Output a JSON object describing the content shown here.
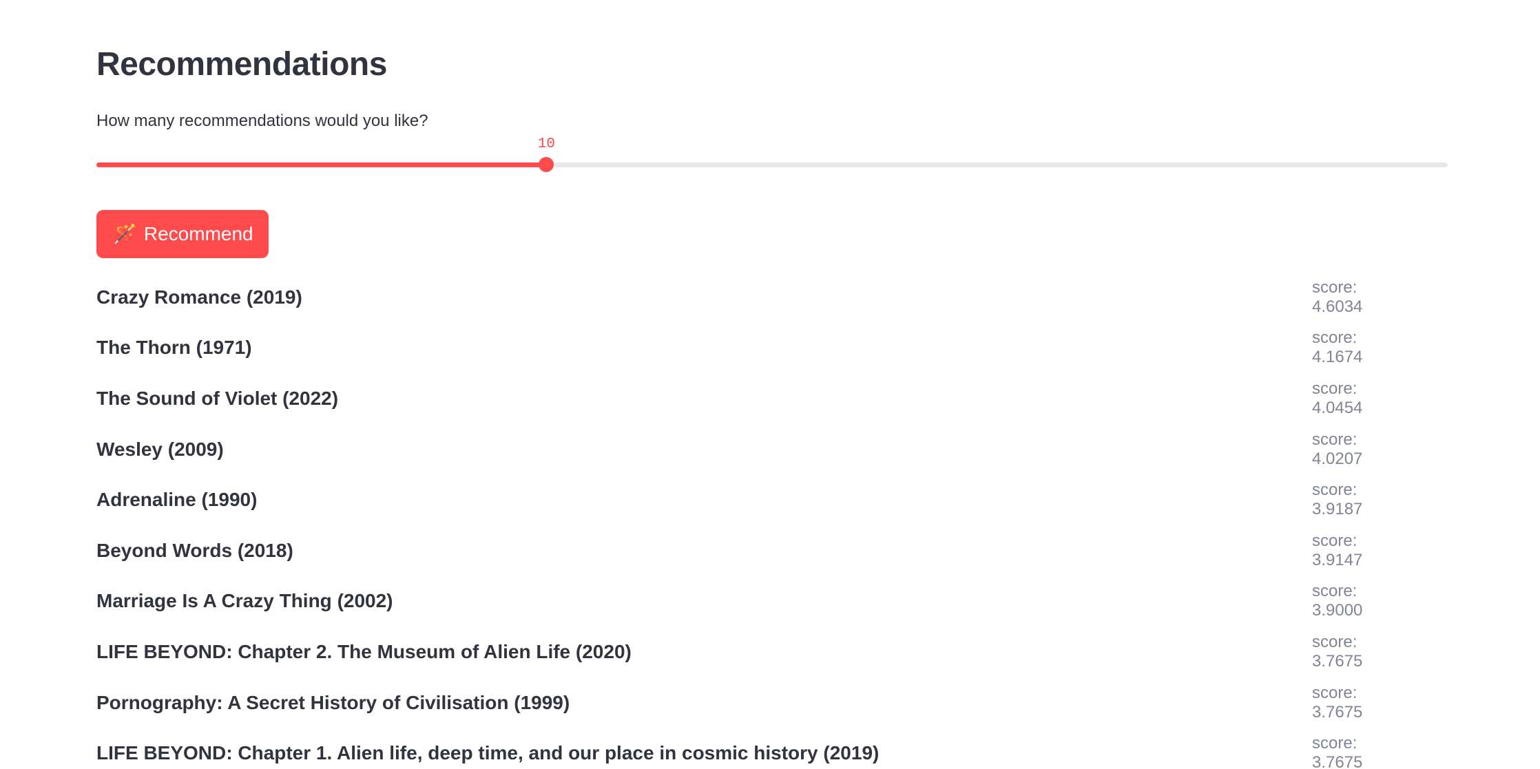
{
  "page_title": "Recommendations",
  "slider": {
    "label": "How many recommendations would you like?",
    "value": "10",
    "fraction": 0.333
  },
  "button": {
    "icon": "magic-wand-icon",
    "label": "Recommend"
  },
  "results": [
    {
      "title": "Crazy Romance (2019)",
      "score": "score: 4.6034"
    },
    {
      "title": "The Thorn (1971)",
      "score": "score: 4.1674"
    },
    {
      "title": "The Sound of Violet (2022)",
      "score": "score: 4.0454"
    },
    {
      "title": "Wesley (2009)",
      "score": "score: 4.0207"
    },
    {
      "title": "Adrenaline (1990)",
      "score": "score: 3.9187"
    },
    {
      "title": "Beyond Words (2018)",
      "score": "score: 3.9147"
    },
    {
      "title": "Marriage Is A Crazy Thing (2002)",
      "score": "score: 3.9000"
    },
    {
      "title": "LIFE BEYOND: Chapter 2. The Museum of Alien Life (2020)",
      "score": "score: 3.7675"
    },
    {
      "title": "Pornography: A Secret History of Civilisation (1999)",
      "score": "score: 3.7675"
    },
    {
      "title": "LIFE BEYOND: Chapter 1. Alien life, deep time, and our place in cosmic history (2019)",
      "score": "score: 3.7675"
    }
  ],
  "colors": {
    "accent": "#ff4b4b",
    "text": "#31333f",
    "muted": "#808495",
    "track": "#e6e8ec"
  }
}
